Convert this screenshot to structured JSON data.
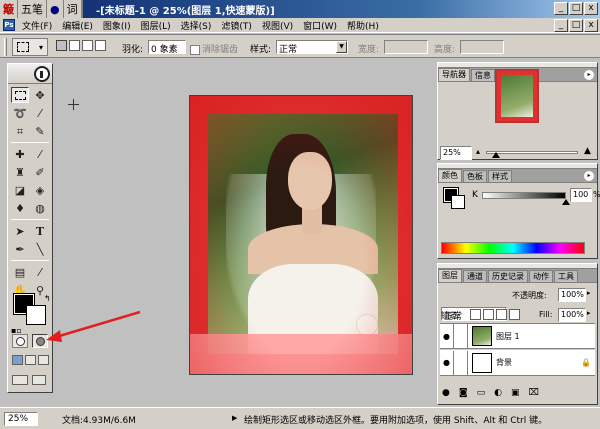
{
  "ime": {
    "logo": "簸",
    "mode": "五笔",
    "punct": "●",
    "fullwidth": "词"
  },
  "title": "-[未标题-1 @ 25%(图层 1,快速蒙版)]",
  "window_buttons": [
    "_",
    "□",
    "x"
  ],
  "mdi_buttons": [
    "_",
    "□",
    "x"
  ],
  "menu": {
    "app_icon": "Ps",
    "items": [
      "文件(F)",
      "编辑(E)",
      "图象(I)",
      "图层(L)",
      "选择(S)",
      "滤镜(T)",
      "视图(V)",
      "窗口(W)",
      "帮助(H)"
    ]
  },
  "options": {
    "feather_label": "羽化:",
    "feather_value": "0 象素",
    "antialias_label": "消除锯齿",
    "style_label": "样式:",
    "style_value": "正常",
    "width_label": "宽度:",
    "height_label": "高度:"
  },
  "navigator": {
    "tabs": [
      "导航器",
      "信息"
    ],
    "zoom": "25%"
  },
  "color": {
    "tabs": [
      "颜色",
      "色板",
      "样式"
    ],
    "channel": "K",
    "value": "100",
    "unit": "%"
  },
  "layers": {
    "tabs": [
      "图层",
      "通道",
      "历史记录",
      "动作",
      "工具"
    ],
    "blend_mode": "正常",
    "opacity_label": "不透明度:",
    "opacity_value": "100%",
    "lock_label": "锁定:",
    "fill_label": "Fill:",
    "fill_value": "100%",
    "rows": [
      {
        "name": "图层 1",
        "visible": "●"
      },
      {
        "name": "背景",
        "visible": "●"
      }
    ]
  },
  "status": {
    "zoom": "25%",
    "doc_info": "文档:4.93M/6.6M",
    "hint": "绘制矩形选区或移动选区外框。要用附加选项，使用 Shift、Alt 和 Ctrl 键。"
  },
  "colors": {
    "titlebar": "#0a246a",
    "chrome": "#d4d0c8",
    "quickmask": "#e03030",
    "annotation_arrow": "#e02020"
  }
}
